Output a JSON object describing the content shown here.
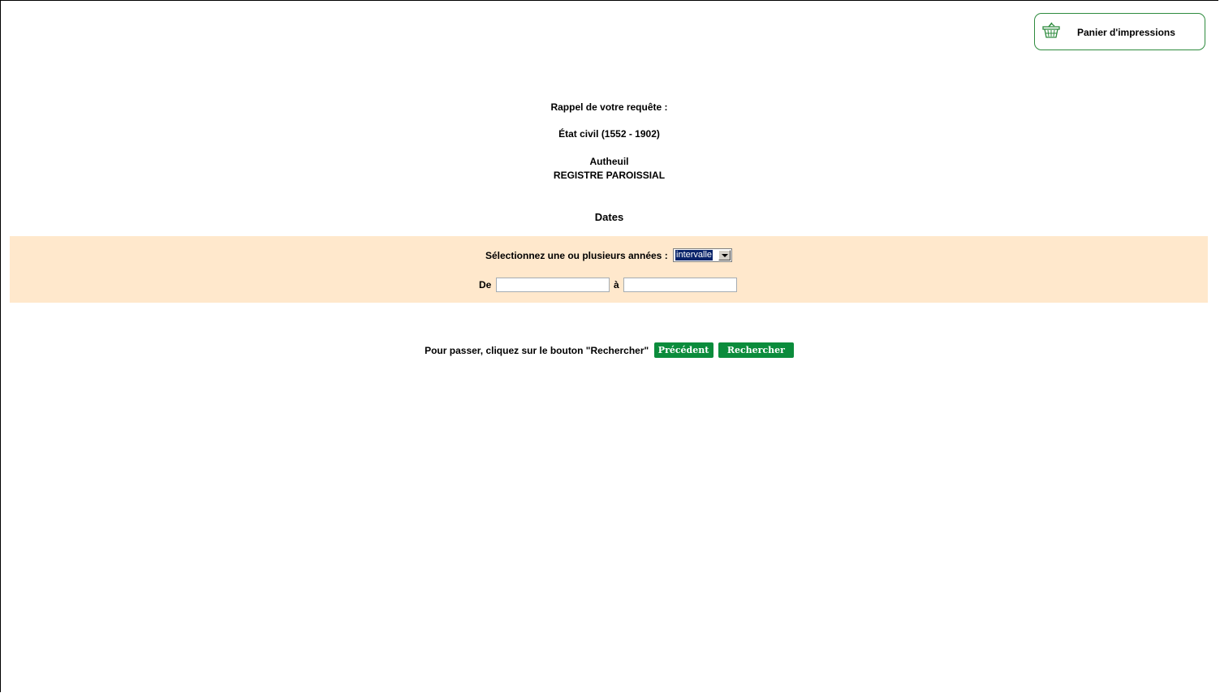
{
  "cart": {
    "label": "Panier d'impressions",
    "icon": "basket-icon"
  },
  "summary": {
    "heading": "Rappel de votre requête :",
    "collection": "État civil (1552 - 1902)",
    "place": "Autheuil",
    "register": "REGISTRE PAROISSIAL"
  },
  "dates": {
    "heading": "Dates",
    "select_label": "Sélectionnez une ou plusieurs années :",
    "select_value": "intervalle",
    "from_label": "De",
    "from_value": "",
    "to_label": "à",
    "to_value": ""
  },
  "actions": {
    "instruction": "Pour passer, cliquez sur le bouton \"Rechercher\"",
    "previous_label": "Précédent",
    "search_label": "Rechercher"
  },
  "colors": {
    "band_background": "#ffe8cc",
    "button_green": "#0b8c3c",
    "cart_border": "#2e8b3e"
  }
}
